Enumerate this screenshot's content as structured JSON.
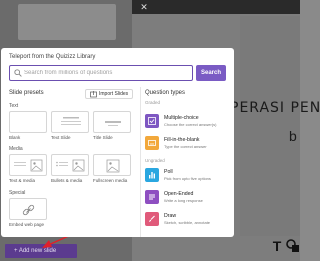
{
  "background": {
    "editor_title": "PERASI PEN",
    "editor_title_2": "b"
  },
  "modal": {
    "title": "Teleport from the Quizizz Library",
    "search": {
      "placeholder": "Search from millions of questions",
      "button": "Search"
    },
    "slide_presets": {
      "heading": "Slide presets",
      "import_button": "Import Slides",
      "text_group": "Text",
      "text_tiles": [
        "Blank",
        "Text Slide",
        "Title Slide"
      ],
      "media_group": "Media",
      "media_tiles": [
        "Text & media",
        "Bullets & media",
        "Fullscreen media"
      ],
      "special_group": "Special",
      "special_tiles": [
        "Embed web page"
      ]
    },
    "question_types": {
      "heading": "Question types",
      "graded_label": "Graded",
      "ungraded_label": "Ungraded",
      "graded": [
        {
          "name": "Multiple-choice",
          "desc": "Choose the correct answer(s)",
          "color": "#7e57c2",
          "icon": "check-square-icon"
        },
        {
          "name": "Fill-in-the-blank",
          "desc": "Type the correct answer",
          "color": "#f2a83b",
          "icon": "blank-box-icon"
        }
      ],
      "ungraded": [
        {
          "name": "Poll",
          "desc": "Pick from upto five options",
          "color": "#2aa7e0",
          "icon": "poll-icon"
        },
        {
          "name": "Open-Ended",
          "desc": "Write a long response",
          "color": "#8e4fc1",
          "icon": "open-ended-icon"
        },
        {
          "name": "Draw",
          "desc": "Sketch, scribble, annotate",
          "color": "#e05a7a",
          "icon": "brush-icon"
        }
      ]
    }
  },
  "sidebar": {
    "add_slide_label": "+ Add new slide"
  },
  "colors": {
    "accent": "#7a5bc4",
    "annotation_arrow": "#e0202a"
  }
}
